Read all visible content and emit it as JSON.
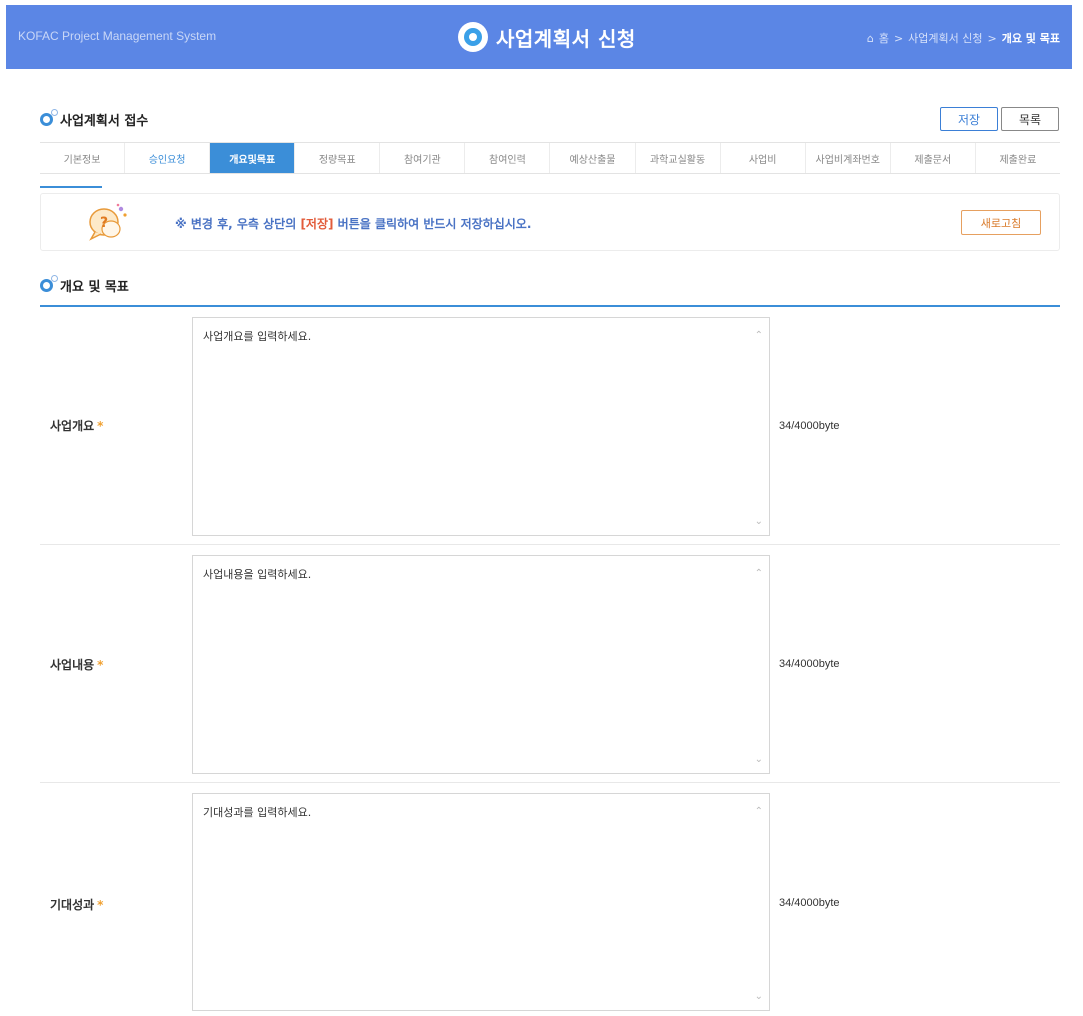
{
  "header": {
    "system_name": "KOFAC Project Management System",
    "page_title": "사업계획서 신청",
    "breadcrumb": {
      "home": "홈",
      "level1": "사업계획서 신청",
      "current": "개요 및 목표"
    },
    "brand_color": "#5b86e5"
  },
  "section1": {
    "title": "사업계획서 접수",
    "save_label": "저장",
    "list_label": "목록"
  },
  "tabs": [
    {
      "label": "기본정보"
    },
    {
      "label": "승인요청"
    },
    {
      "label": "개요및목표"
    },
    {
      "label": "정량목표"
    },
    {
      "label": "참여기관"
    },
    {
      "label": "참여인력"
    },
    {
      "label": "예상산출물"
    },
    {
      "label": "과학교실활동"
    },
    {
      "label": "사업비"
    },
    {
      "label": "사업비계좌번호"
    },
    {
      "label": "제출문서"
    },
    {
      "label": "제출완료"
    }
  ],
  "active_tab": "개요및목표",
  "notice": {
    "prefix": "※ 변경 후, 우측 상단의 ",
    "highlight": "[저장]",
    "suffix": " 버튼을 클릭하여 반드시 저장하십시오.",
    "refresh_label": "새로고침"
  },
  "section2": {
    "title": "개요 및 목표"
  },
  "fields": [
    {
      "label": "사업개요",
      "required_mark": "*",
      "placeholder": "사업개요를 입력하세요.",
      "count": "34/4000byte"
    },
    {
      "label": "사업내용",
      "required_mark": "*",
      "placeholder": "사업내용을 입력하세요.",
      "count": "34/4000byte"
    },
    {
      "label": "기대성과",
      "required_mark": "*",
      "placeholder": "기대성과를 입력하세요.",
      "count": "34/4000byte"
    }
  ],
  "colors": {
    "accent": "#3b8ed8",
    "notice_highlight": "#e25b3a",
    "refresh": "#d97a2a",
    "required": "#f0a030"
  }
}
